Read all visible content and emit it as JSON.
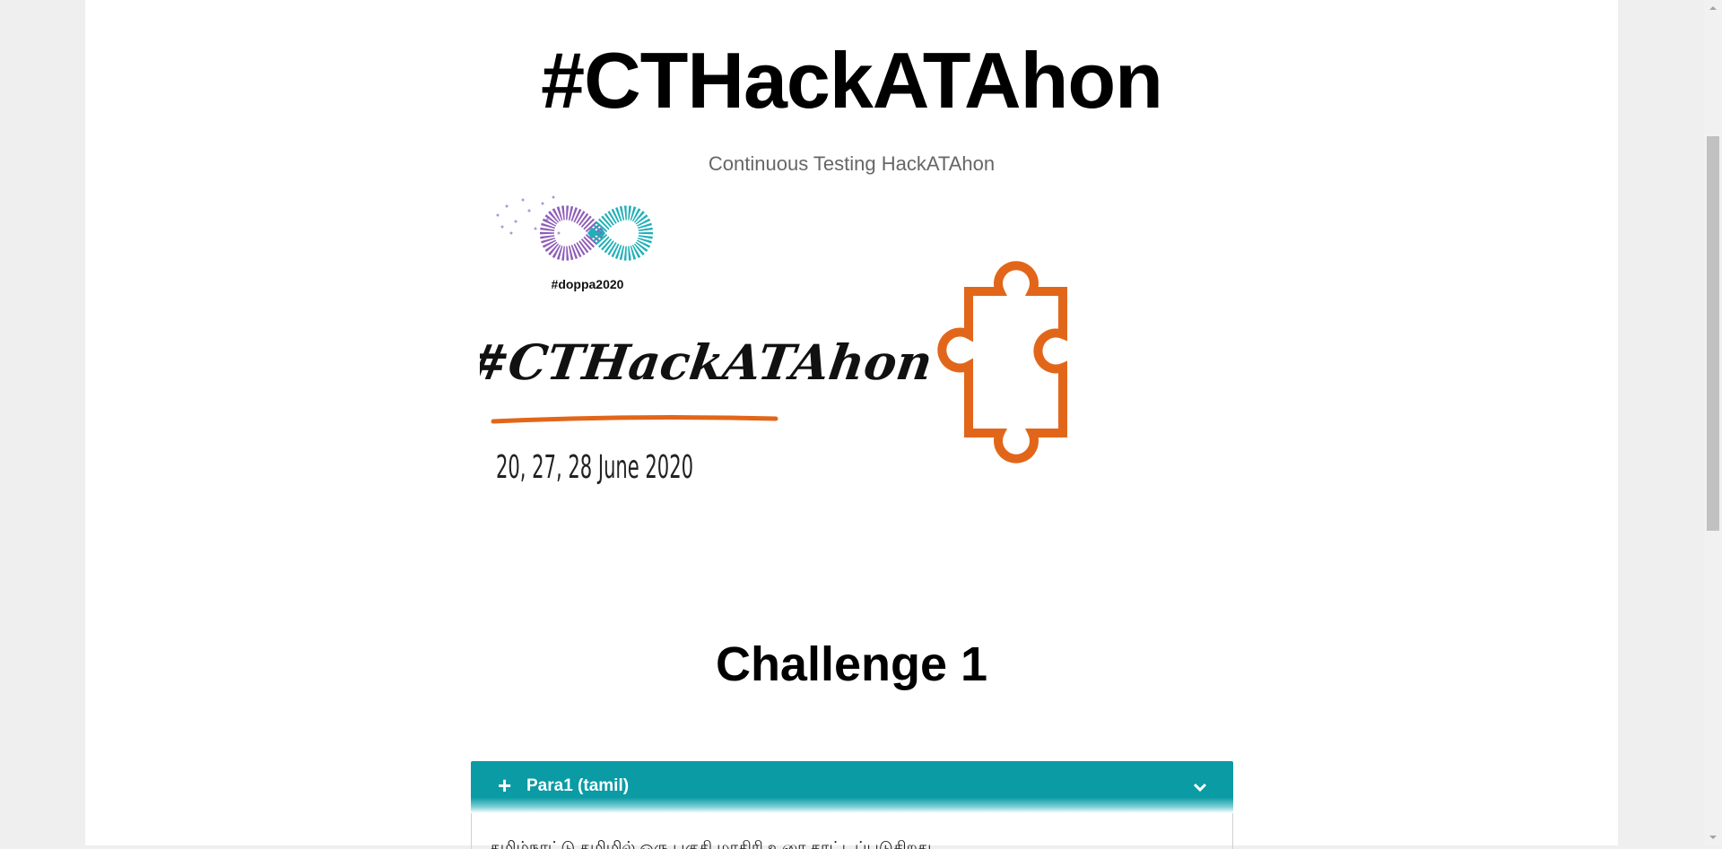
{
  "header": {
    "title": "#CTHackATAhon",
    "subtitle": "Continuous Testing HackATAhon"
  },
  "banner": {
    "logo_hashtag": "#doppa2020",
    "script_title": "#CTHackATAhon",
    "dates": "20, 27, 28 June 2020",
    "icons": [
      "infinity-logo-icon",
      "puzzle-piece-icon"
    ],
    "colors": {
      "orange": "#e2661a",
      "purple": "#8e5db8",
      "teal": "#1fb0b8"
    }
  },
  "challenge": {
    "title": "Challenge 1"
  },
  "accordion": {
    "items": [
      {
        "label": "Para1 (tamil)",
        "expand_icon": "plus-icon",
        "toggle_icon": "chevron-down-icon",
        "color": "#0a9ba5"
      }
    ],
    "body_text": "தமிழ்நாட்டு தமிழில் ஒரு பகுதி மாதிரி உரை காட்டப்படுகிறது"
  }
}
